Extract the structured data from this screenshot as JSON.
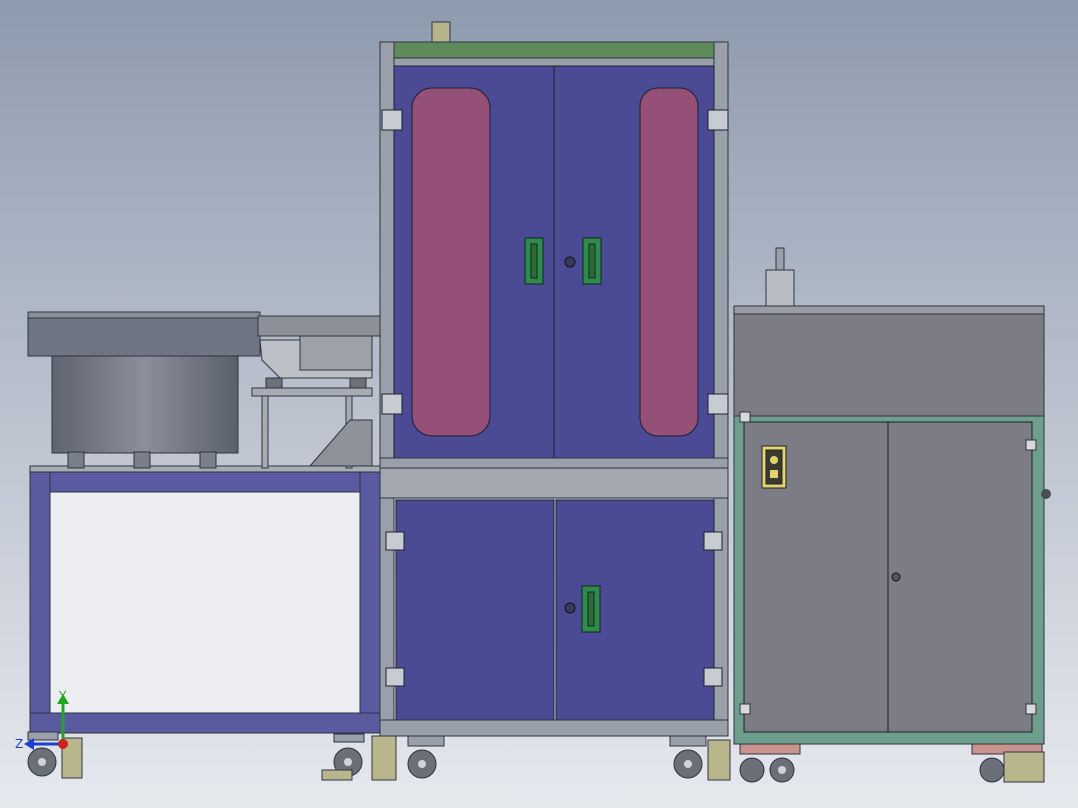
{
  "viewport": {
    "background_top": "#8e9aae",
    "background_bottom": "#e6e9ee"
  },
  "colors": {
    "door_blue": "#4a4a95",
    "window_pink": "#955078",
    "frame_gray": "#9aa0aa",
    "frame_edge": "#2e3440",
    "top_rail_green": "#5f8a5c",
    "handle_green": "#2f8a4d",
    "table_purple": "#5a5aa0",
    "bowl_gray": "#6f7582",
    "bowl_top": "#8a8e98",
    "cabinet_gray": "#7b7c84",
    "panel_teal": "#6e9e8e",
    "bracket_pink": "#c9928c",
    "dial_yellow": "#e4d36a",
    "foot_khaki": "#b9b68c"
  },
  "triad": {
    "y_label": "Y",
    "z_label": "Z",
    "y_color": "#1fa81f",
    "z_color": "#1f3fd0",
    "x_color": "#d01f1f"
  },
  "components": {
    "feeder_bowl": "vibratory-feeder-bowl",
    "main_cabinet": "enclosed-cabinet-with-windows",
    "control_cabinet": "electrical-control-cabinet",
    "support_table": "feeder-support-table"
  }
}
